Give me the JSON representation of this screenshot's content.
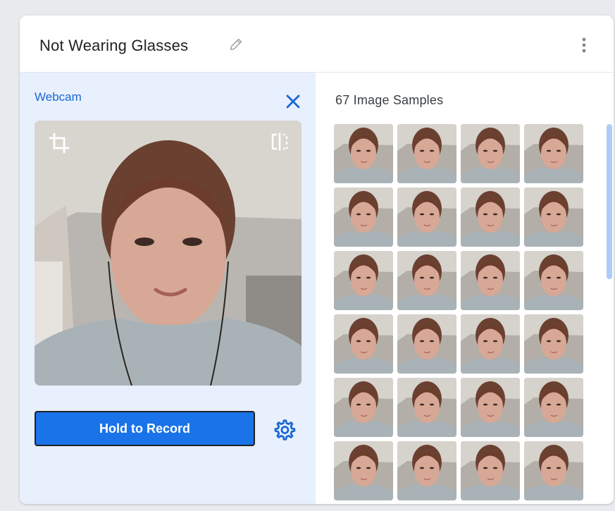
{
  "class_card": {
    "title": "Not Wearing Glasses",
    "icons": {
      "edit": "pencil-icon",
      "more": "more-vertical-icon"
    }
  },
  "webcam": {
    "label": "Webcam",
    "close_icon": "close-icon",
    "preview_icons": [
      "crop-icon",
      "flip-icon"
    ],
    "record_button_label": "Hold to Record",
    "settings_icon": "gear-icon"
  },
  "samples": {
    "count_label": "67 Image Samples",
    "visible_thumbnails": 24
  },
  "colors": {
    "accent": "#1a73e8",
    "accent_text": "#1967d2",
    "panel_bg": "#e8f0fe",
    "scrollbar": "#aecbfa"
  }
}
